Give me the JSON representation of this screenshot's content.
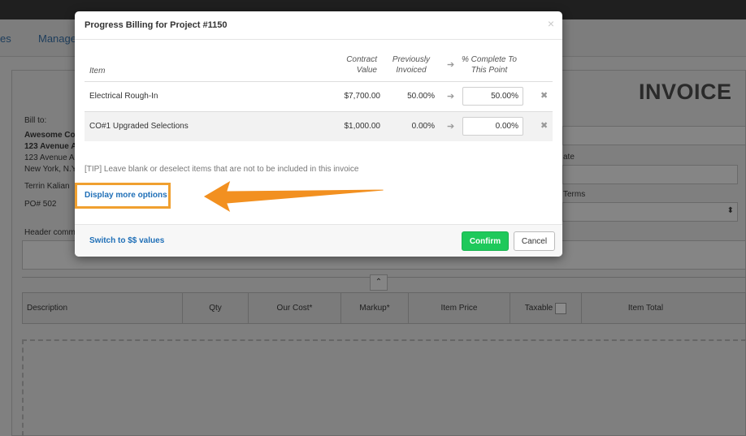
{
  "background": {
    "nav_items": [
      "es",
      "Manage"
    ],
    "invoice_title": "INVOICE",
    "bill_to_label": "Bill to:",
    "bill_to_lines": [
      "Awesome Co",
      "123 Avenue A",
      "123 Avenue A",
      "New York, N.Y"
    ],
    "contact": "Terrin Kalian",
    "po": "PO# 502",
    "header_comment": "Header comm",
    "side_labels": [
      "ate",
      "Terms"
    ],
    "table_columns": [
      "Description",
      "Qty",
      "Our Cost*",
      "Markup*",
      "Item Price",
      "Taxable",
      "Item Total"
    ]
  },
  "modal": {
    "title": "Progress Billing for Project #1150",
    "close_glyph": "×",
    "headers": {
      "item": "Item",
      "contract_value": [
        "Contract",
        "Value"
      ],
      "previously_invoiced": [
        "Previously",
        "Invoiced"
      ],
      "percent_complete": [
        "% Complete To",
        "This Point"
      ]
    },
    "rows": [
      {
        "item": "Electrical Rough-In",
        "contract_value": "$7,700.00",
        "previously_invoiced": "50.00%",
        "percent_complete": "50.00%"
      },
      {
        "item": "CO#1 Upgraded Selections",
        "contract_value": "$1,000.00",
        "previously_invoiced": "0.00%",
        "percent_complete": "0.00%"
      }
    ],
    "tip": "[TIP] Leave blank or deselect items that are not to be included in this invoice",
    "more_options_link": "Display more options",
    "footer": {
      "switch_link": "Switch to $$ values",
      "confirm_label": "Confirm",
      "cancel_label": "Cancel"
    }
  },
  "colors": {
    "accent_link": "#1f6fb7",
    "confirm_green": "#1ec95b",
    "callout_orange": "#f0a030"
  },
  "icons": {
    "arrow": "arrow-right-icon",
    "delete": "remove-x-icon",
    "close": "close-icon",
    "callout": "orange-callout-arrow"
  }
}
